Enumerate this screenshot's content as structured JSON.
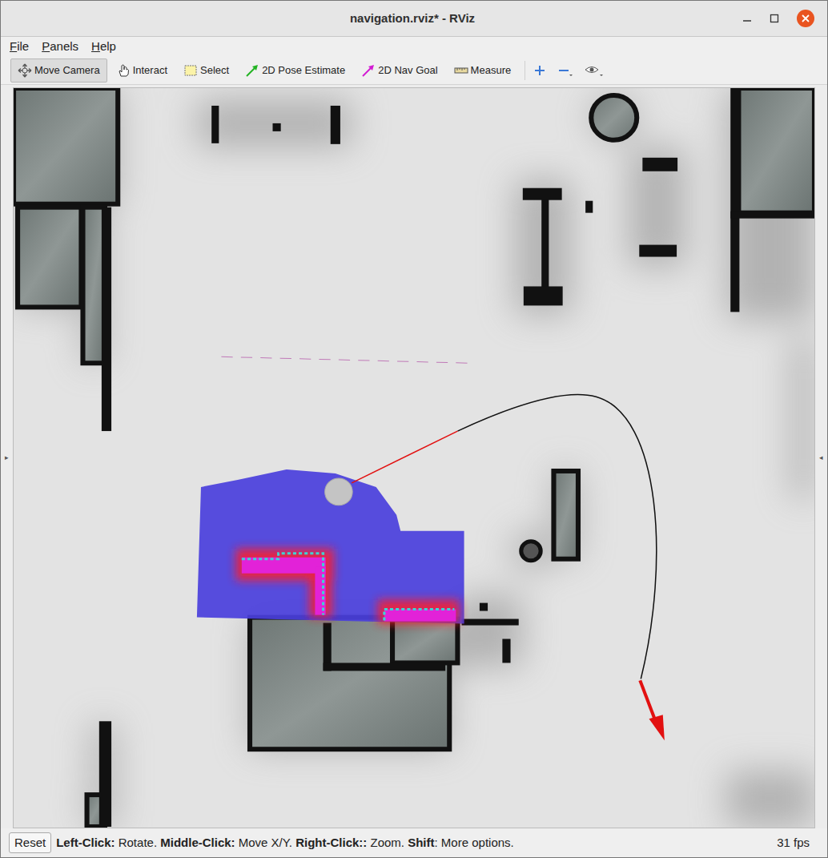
{
  "window": {
    "title": "navigation.rviz* - RViz"
  },
  "menu": [
    {
      "underlined": "F",
      "rest": "ile"
    },
    {
      "underlined": "P",
      "rest": "anels"
    },
    {
      "underlined": "H",
      "rest": "elp"
    }
  ],
  "tools": [
    {
      "label": "Move Camera",
      "selected": true
    },
    {
      "label": "Interact",
      "selected": false
    },
    {
      "label": "Select",
      "selected": false
    },
    {
      "label": "2D Pose Estimate",
      "selected": false
    },
    {
      "label": "2D Nav Goal",
      "selected": false
    },
    {
      "label": "Measure",
      "selected": false
    }
  ],
  "side_toggles": [
    "▸",
    "◂"
  ],
  "status_bar": {
    "reset": "Reset",
    "hint": [
      {
        "text": "Left-Click:",
        "bold": true
      },
      {
        "text": " Rotate. ",
        "bold": false
      },
      {
        "text": "Middle-Click:",
        "bold": true
      },
      {
        "text": " Move X/Y. ",
        "bold": false
      },
      {
        "text": "Right-Click::",
        "bold": true
      },
      {
        "text": " Zoom. ",
        "bold": false
      },
      {
        "text": "Shift",
        "bold": true
      },
      {
        "text": ": More options.",
        "bold": false
      }
    ],
    "fps": "31 fps"
  }
}
